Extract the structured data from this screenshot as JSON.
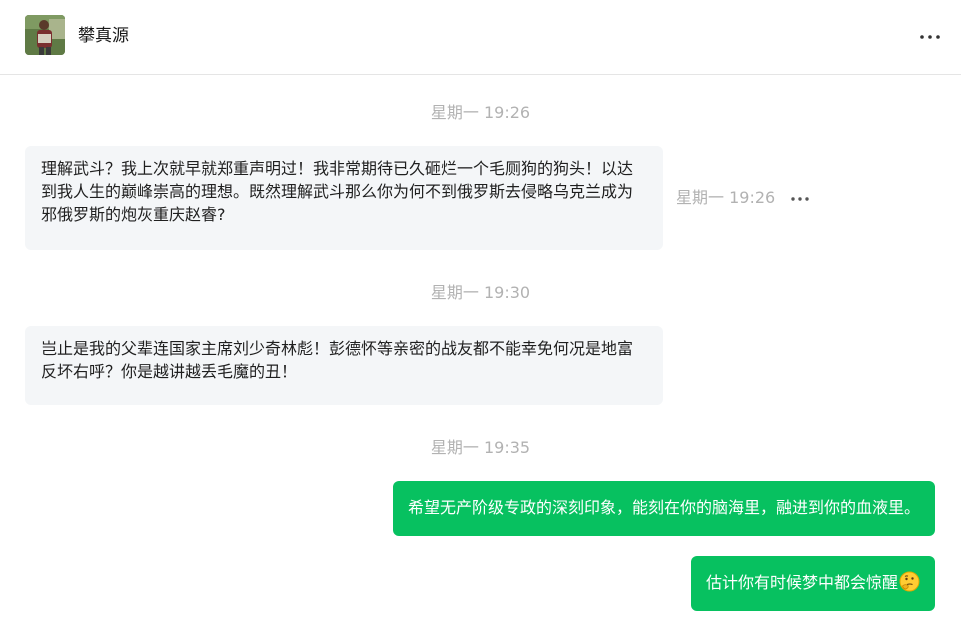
{
  "header": {
    "contact_name": "攀真源",
    "more_icon": "more-horizontal-icon",
    "avatar_icon": "contact-avatar"
  },
  "messages": [
    {
      "timestamp": "星期一 19:26",
      "direction": "received",
      "text": "理解武斗？我上次就早就郑重声明过！我非常期待已久砸烂一个毛厕狗的狗头！以达到我人生的巅峰崇高的理想。既然理解武斗那么你为何不到俄罗斯去侵略乌克兰成为邪俄罗斯的炮灰重庆赵睿?",
      "hover_time": "星期一 19:26"
    },
    {
      "timestamp": "星期一 19:30",
      "direction": "received",
      "text": "岂止是我的父辈连国家主席刘少奇林彪！彭德怀等亲密的战友都不能幸免何况是地富反坏右呼？你是越讲越丢毛魔的丑！"
    },
    {
      "timestamp": "星期一 19:35",
      "direction": "sent",
      "text": "希望无产阶级专政的深刻印象，能刻在你的脑海里，融进到你的血液里。"
    },
    {
      "direction": "sent",
      "text": "估计你有时候梦中都会惊醒",
      "emoji_icon": "thinking-face-emoji-icon"
    }
  ],
  "colors": {
    "sent_bubble": "#07c160",
    "received_bubble": "#f4f6f8",
    "timestamp_text": "#b2b2b2"
  }
}
